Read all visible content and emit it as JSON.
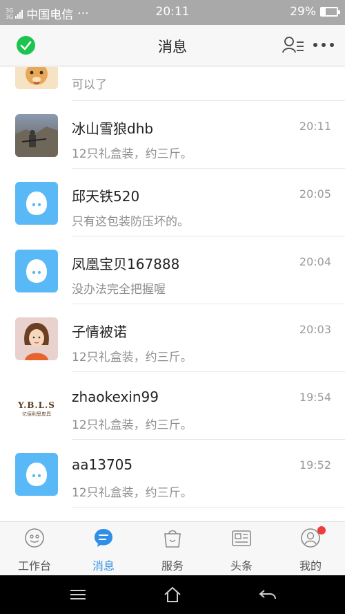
{
  "status_bar": {
    "network_top": "3G",
    "network_bottom": "3G",
    "carrier": "中国电信",
    "dots": "···",
    "time": "20:11",
    "battery_percent": "29%",
    "battery_level": 0.29
  },
  "header": {
    "title": "消息",
    "status_color": "#1dc44f"
  },
  "conversations": [
    {
      "name": "",
      "time": "",
      "preview": "可以了",
      "avatar": "bear-avatar"
    },
    {
      "name": "冰山雪狼dhb",
      "time": "20:11",
      "preview": "12只礼盒装，约三斤。",
      "avatar": "photo-avatar"
    },
    {
      "name": "邱天铁520",
      "time": "20:05",
      "preview": "只有这包装防压坏的。",
      "avatar": "qq-default-avatar"
    },
    {
      "name": "凤凰宝贝167888",
      "time": "20:04",
      "preview": "没办法完全把握喔",
      "avatar": "qq-default-avatar"
    },
    {
      "name": "子情被诺",
      "time": "20:03",
      "preview": "12只礼盒装，约三斤。",
      "avatar": "cartoon-avatar"
    },
    {
      "name": "zhaokexin99",
      "time": "19:54",
      "preview": "12只礼盒装，约三斤。",
      "avatar": "ybls-logo-avatar",
      "logo_text": "Y.B.L.S",
      "logo_subtext": "亿佰利思皮具"
    },
    {
      "name": "aa13705",
      "time": "19:52",
      "preview": "12只礼盒装，约三斤。",
      "avatar": "qq-default-avatar"
    }
  ],
  "tabs": [
    {
      "label": "工作台",
      "icon": "workbench-icon",
      "active": false
    },
    {
      "label": "消息",
      "icon": "message-icon",
      "active": true
    },
    {
      "label": "服务",
      "icon": "service-bag-icon",
      "active": false
    },
    {
      "label": "头条",
      "icon": "news-icon",
      "active": false
    },
    {
      "label": "我的",
      "icon": "profile-icon",
      "active": false,
      "badge": true
    }
  ],
  "colors": {
    "accent": "#2f8fe6",
    "qq_avatar": "#59b9f6",
    "badge": "#f03c3c"
  }
}
